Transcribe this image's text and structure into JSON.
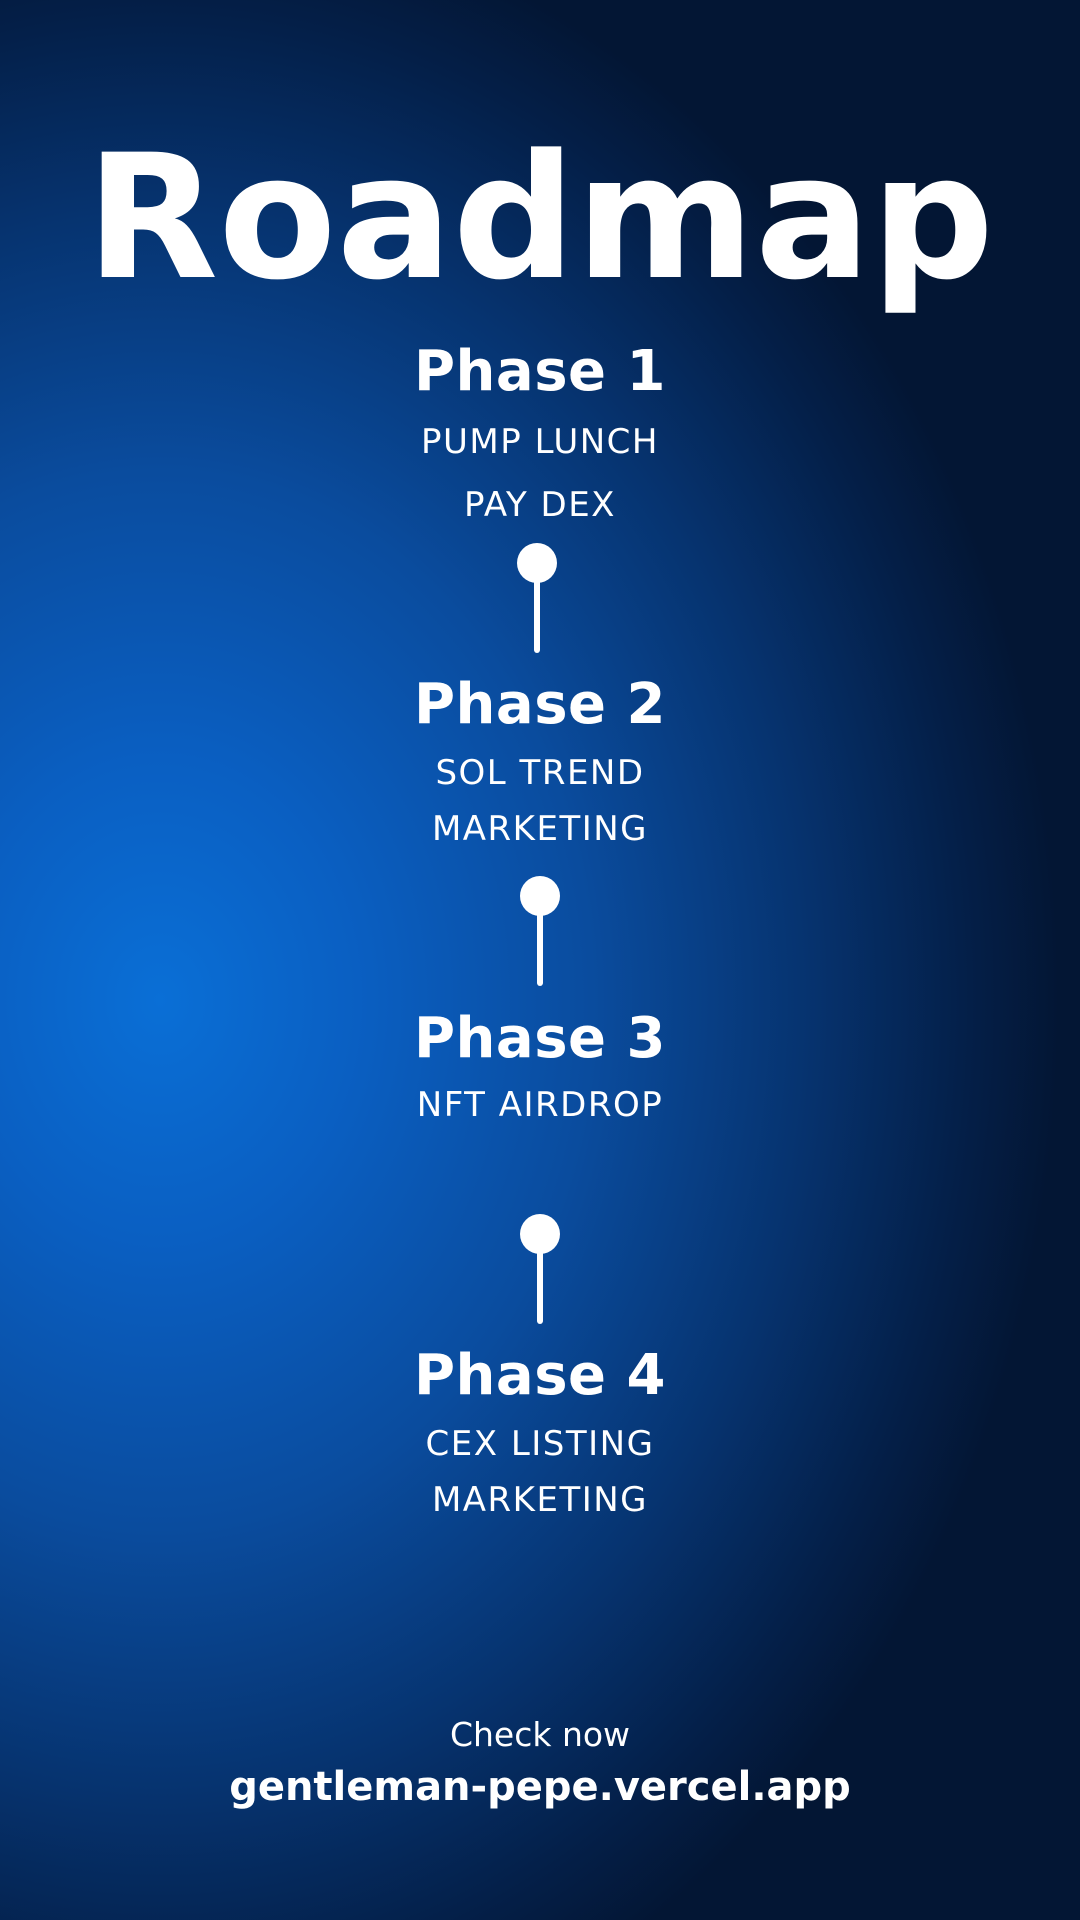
{
  "title": "Roadmap",
  "phases": [
    {
      "title": "Phase 1",
      "items": [
        "PUMP LUNCH",
        "PAY DEX"
      ]
    },
    {
      "title": "Phase 2",
      "items": [
        "SOL TREND",
        "MARKETING"
      ]
    },
    {
      "title": "Phase 3",
      "items": [
        "NFT AIRDROP"
      ]
    },
    {
      "title": "Phase 4",
      "items": [
        "CEX LISTING",
        "MARKETING"
      ]
    }
  ],
  "footer": {
    "cta": "Check now",
    "url": "gentleman-pepe.vercel.app"
  },
  "icons": [
    "timeline-pin-icon",
    "timeline-pin-icon",
    "timeline-pin-icon"
  ],
  "colors": {
    "background_light": "#0a6fd6",
    "background_dark": "#031634",
    "text": "#ffffff"
  }
}
